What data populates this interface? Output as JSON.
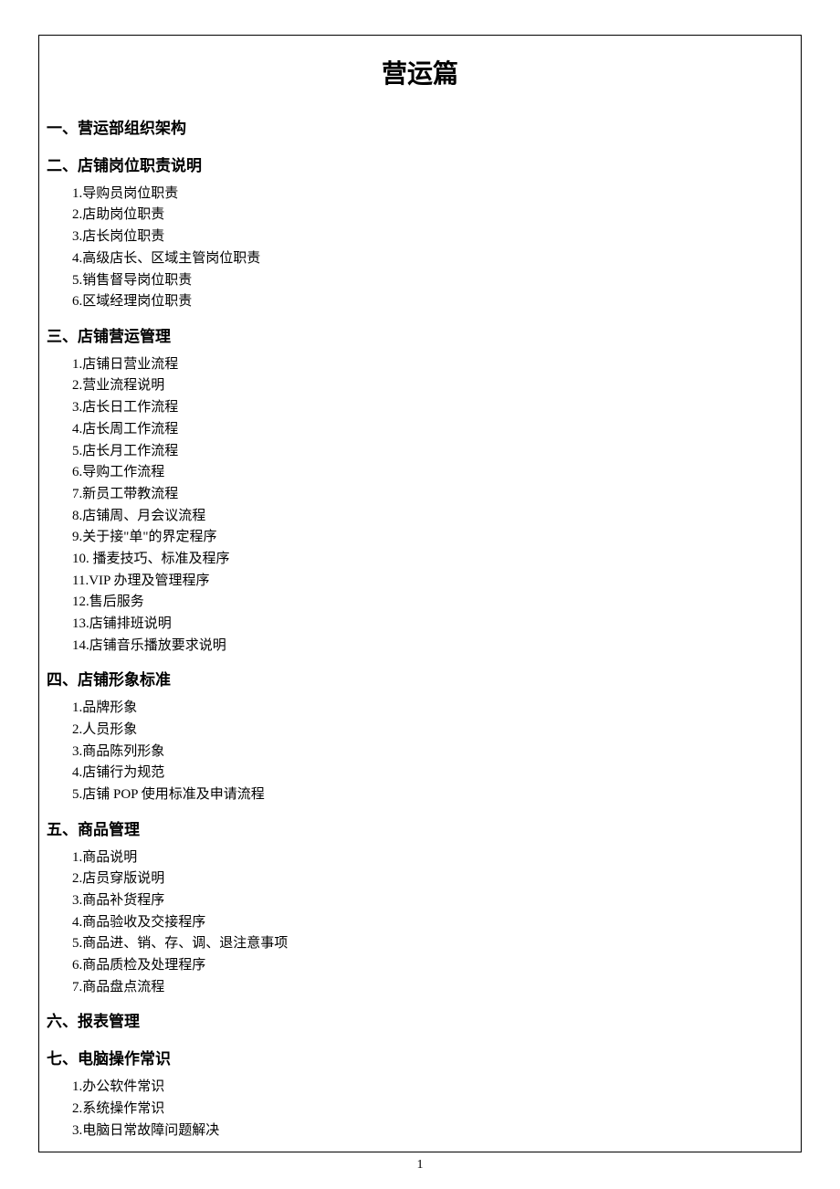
{
  "title": "营运篇",
  "pageNumber": "1",
  "sections": [
    {
      "heading": "一、营运部组织架构",
      "items": []
    },
    {
      "heading": "二、店铺岗位职责说明",
      "items": [
        "1.导购员岗位职责",
        "2.店助岗位职责",
        "3.店长岗位职责",
        "4.高级店长、区域主管岗位职责",
        "5.销售督导岗位职责",
        "6.区域经理岗位职责"
      ]
    },
    {
      "heading": "三、店铺营运管理",
      "items": [
        "1.店铺日营业流程",
        "2.营业流程说明",
        "3.店长日工作流程",
        "4.店长周工作流程",
        "5.店长月工作流程",
        "6.导购工作流程",
        "7.新员工带教流程",
        "8.店铺周、月会议流程",
        "9.关于接\"单\"的界定程序",
        "10.  播麦技巧、标准及程序",
        "11.VIP 办理及管理程序",
        "12.售后服务",
        "13.店铺排班说明",
        "14.店铺音乐播放要求说明"
      ]
    },
    {
      "heading": "四、店铺形象标准",
      "items": [
        "1.品牌形象",
        "2.人员形象",
        "3.商品陈列形象",
        "4.店铺行为规范",
        "5.店铺 POP 使用标准及申请流程"
      ]
    },
    {
      "heading": "五、商品管理",
      "items": [
        "1.商品说明",
        "2.店员穿版说明",
        "3.商品补货程序",
        "4.商品验收及交接程序",
        "5.商品进、销、存、调、退注意事项",
        "6.商品质检及处理程序",
        "7.商品盘点流程"
      ]
    },
    {
      "heading": "六、报表管理",
      "items": []
    },
    {
      "heading": "七、电脑操作常识",
      "items": [
        "1.办公软件常识",
        "2.系统操作常识",
        "3.电脑日常故障问题解决"
      ]
    }
  ]
}
